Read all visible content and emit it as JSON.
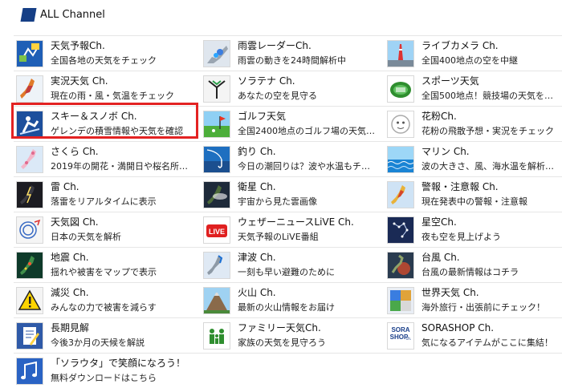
{
  "header": {
    "title": "ALL Channel"
  },
  "rows": [
    [
      {
        "name": "天気予報Ch.",
        "desc": "全国各地の天気をチェック",
        "icon": "forecast-icon"
      },
      {
        "name": "雨雲レーダーCh.",
        "desc": "雨雲の動きを24時間解析中",
        "icon": "rain-radar-icon"
      },
      {
        "name": "ライブカメラ Ch.",
        "desc": "全国400地点の空を中継",
        "icon": "live-camera-icon"
      }
    ],
    [
      {
        "name": "実況天気 Ch.",
        "desc": "現在の雨・風・気温をチェック",
        "icon": "current-weather-icon"
      },
      {
        "name": "ソラテナ Ch.",
        "desc": "あなたの空を見守る",
        "icon": "soratena-icon"
      },
      {
        "name": "スポーツ天気",
        "desc": "全国500地点！競技場の天気を…",
        "icon": "sports-weather-icon"
      }
    ],
    [
      {
        "name": "スキー＆スノボ Ch.",
        "desc": "ゲレンデの積雪情報や天気を確認",
        "icon": "ski-icon"
      },
      {
        "name": "ゴルフ天気",
        "desc": "全国2400地点のゴルフ場の天気…",
        "icon": "golf-icon"
      },
      {
        "name": "花粉Ch.",
        "desc": "花粉の飛散予想・実況をチェック",
        "icon": "pollen-icon"
      }
    ],
    [
      {
        "name": "さくら Ch.",
        "desc": "2019年の開花・満開日や桜名所…",
        "icon": "sakura-icon"
      },
      {
        "name": "釣り Ch.",
        "desc": "今日の潮回りは？波や水温もチ…",
        "icon": "fishing-icon"
      },
      {
        "name": "マリン Ch.",
        "desc": "波の大きさ、風、海水温を解析…",
        "icon": "marine-icon"
      }
    ],
    [
      {
        "name": "雷 Ch.",
        "desc": "落雷をリアルタイムに表示",
        "icon": "thunder-icon"
      },
      {
        "name": "衛星 Ch.",
        "desc": "宇宙から見た雲画像",
        "icon": "satellite-icon"
      },
      {
        "name": "警報・注意報 Ch.",
        "desc": "現在発表中の警報・注意報",
        "icon": "warning-map-icon"
      }
    ],
    [
      {
        "name": "天気図 Ch.",
        "desc": "日本の天気を解析",
        "icon": "weather-map-icon"
      },
      {
        "name": "ウェザーニュースLiVE Ch.",
        "desc": "天気予報のLiVE番組",
        "icon": "live-icon"
      },
      {
        "name": "星空Ch.",
        "desc": "夜も空を見上げよう",
        "icon": "starry-sky-icon"
      }
    ],
    [
      {
        "name": "地震 Ch.",
        "desc": "揺れや被害をマップで表示",
        "icon": "earthquake-icon"
      },
      {
        "name": "津波 Ch.",
        "desc": "一刻も早い避難のために",
        "icon": "tsunami-icon"
      },
      {
        "name": "台風 Ch.",
        "desc": "台風の最新情報はコチラ",
        "icon": "typhoon-icon"
      }
    ],
    [
      {
        "name": "減災 Ch.",
        "desc": "みんなの力で被害を減らす",
        "icon": "disaster-warning-icon"
      },
      {
        "name": "火山 Ch.",
        "desc": "最新の火山情報をお届け",
        "icon": "volcano-icon"
      },
      {
        "name": "世界天気 Ch.",
        "desc": "海外旅行・出張前にチェック！",
        "icon": "world-weather-icon"
      }
    ],
    [
      {
        "name": "長期見解",
        "desc": "今後3か月の天候を解説",
        "icon": "long-term-icon"
      },
      {
        "name": "ファミリー天気Ch.",
        "desc": "家族の天気を見守ろう",
        "icon": "family-icon"
      },
      {
        "name": "SORASHOP Ch.",
        "desc": "気になるアイテムがここに集結！",
        "icon": "sorashop-icon",
        "icon_text": [
          "SORA",
          "SHOP",
          "ch."
        ]
      }
    ],
    [
      {
        "name": "「ソラウタ」で笑顔になろう！",
        "desc": "無料ダウンロードはこちら",
        "icon": "music-notes-icon"
      }
    ]
  ],
  "live_badge": "LIVE",
  "colors": {
    "highlight": "#e32222",
    "logo": "#163f86",
    "divider": "#e6e6e6"
  }
}
